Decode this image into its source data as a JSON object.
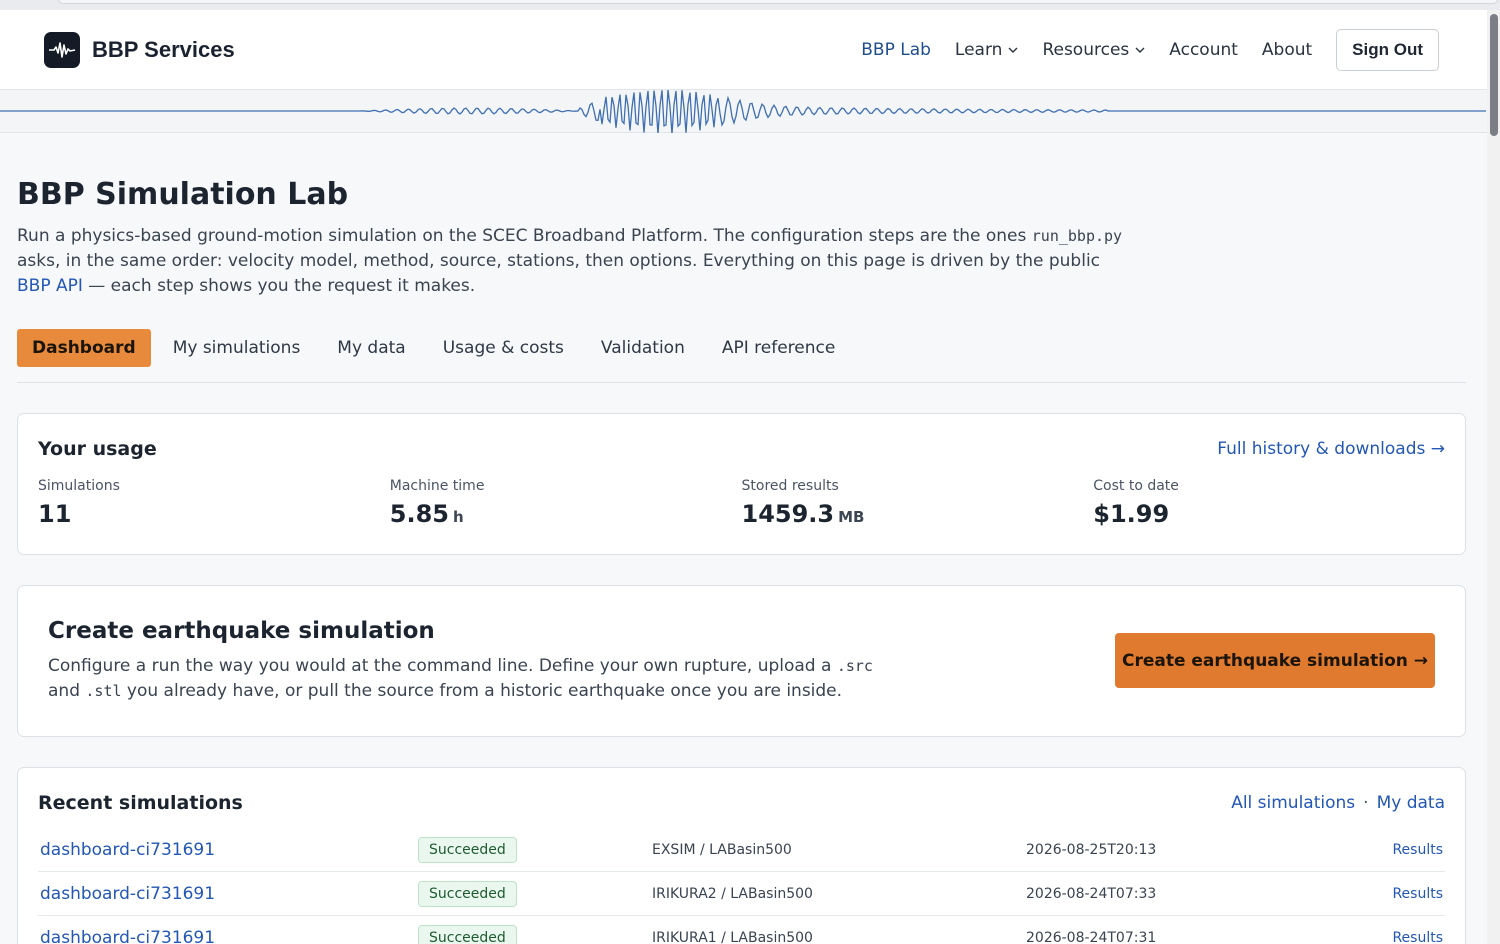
{
  "header": {
    "brand": "BBP Services",
    "nav": {
      "bbp_lab": "BBP Lab",
      "learn": "Learn",
      "resources": "Resources",
      "account": "Account",
      "about": "About"
    },
    "sign_out": "Sign Out"
  },
  "page": {
    "title": "BBP Simulation Lab",
    "intro_part1": "Run a physics-based ground-motion simulation on the SCEC Broadband Platform. The configuration steps are the ones ",
    "intro_code": "run_bbp.py",
    "intro_part2": " asks, in the same order: velocity model, method, source, stations, then options. Everything on this page is driven by the public ",
    "intro_link": "BBP API",
    "intro_part3": " — each step shows you the request it makes."
  },
  "tabs": [
    "Dashboard",
    "My simulations",
    "My data",
    "Usage & costs",
    "Validation",
    "API reference"
  ],
  "usage": {
    "title": "Your usage",
    "history_link": "Full history & downloads →",
    "stats": [
      {
        "label": "Simulations",
        "value": "11",
        "unit": ""
      },
      {
        "label": "Machine time",
        "value": "5.85",
        "unit": "h"
      },
      {
        "label": "Stored results",
        "value": "1459.3",
        "unit": "MB"
      },
      {
        "label": "Cost to date",
        "value": "$1.99",
        "unit": ""
      }
    ]
  },
  "create": {
    "title": "Create earthquake simulation",
    "desc_part1": "Configure a run the way you would at the command line. Define your own rupture, upload a ",
    "desc_code1": ".src",
    "desc_part2": " and ",
    "desc_code2": ".stl",
    "desc_part3": " you already have, or pull the source from a historic earthquake once you are inside.",
    "button": "Create earthquake simulation →"
  },
  "recent": {
    "title": "Recent simulations",
    "all_link": "All simulations",
    "separator": "·",
    "data_link": "My data",
    "rows": [
      {
        "name": "dashboard-ci731691",
        "status": "Succeeded",
        "method": "EXSIM / LABasin500",
        "date": "2026-08-25T20:13",
        "action": "Results"
      },
      {
        "name": "dashboard-ci731691",
        "status": "Succeeded",
        "method": "IRIKURA2 / LABasin500",
        "date": "2026-08-24T07:33",
        "action": "Results"
      },
      {
        "name": "dashboard-ci731691",
        "status": "Succeeded",
        "method": "IRIKURA1 / LABasin500",
        "date": "2026-08-24T07:31",
        "action": "Results"
      }
    ]
  },
  "colors": {
    "accent": "#e07a2e",
    "link": "#2257b5",
    "wave": "#3f6fb2",
    "success_bg": "#eaf7ee"
  },
  "icons": {
    "brand": "seismogram-icon",
    "dropdown": "chevron-down-icon"
  }
}
